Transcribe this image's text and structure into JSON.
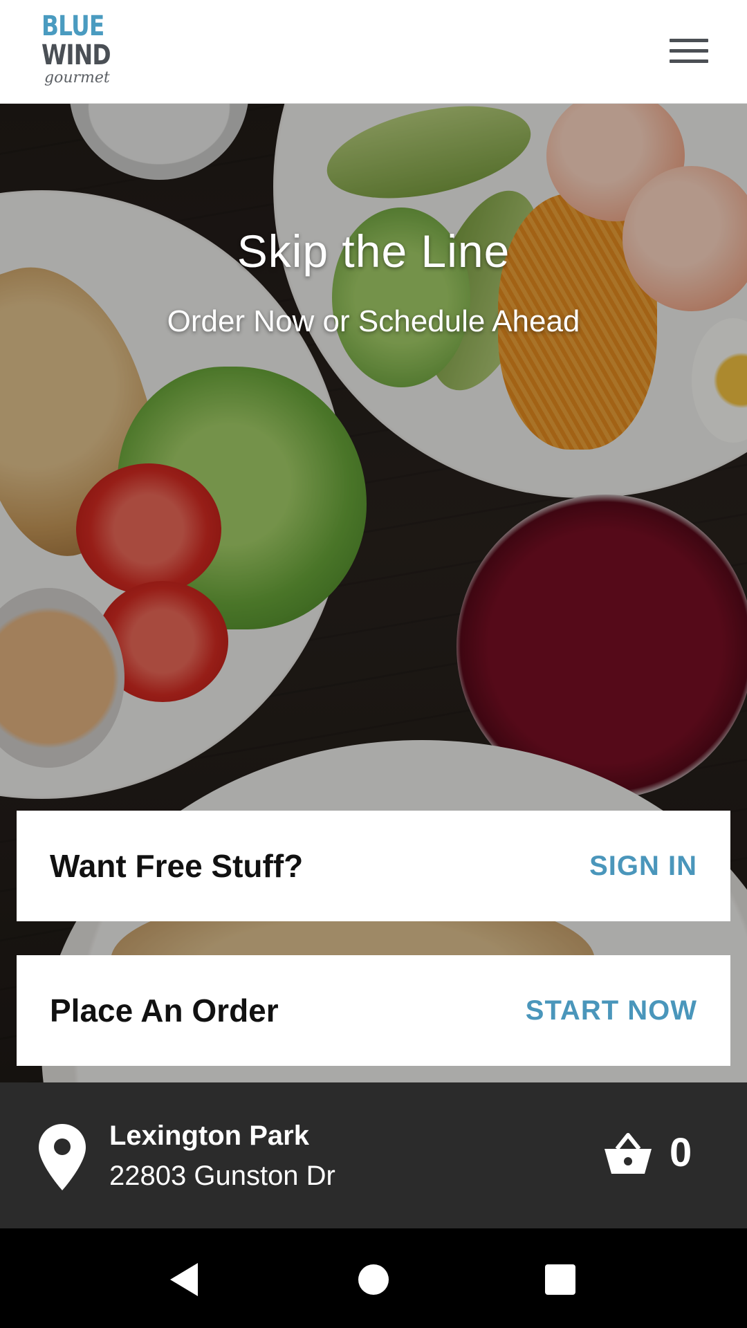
{
  "header": {
    "logo": {
      "line1": "BLUE",
      "line2": "WIND",
      "line3": "gourmet"
    },
    "menu_icon": "hamburger-menu-icon"
  },
  "hero": {
    "title": "Skip the Line",
    "subtitle": "Order Now or Schedule Ahead"
  },
  "cards": {
    "free_stuff": {
      "title": "Want Free Stuff?",
      "action": "SIGN IN"
    },
    "order": {
      "title": "Place An Order",
      "action": "START NOW"
    }
  },
  "location": {
    "name": "Lexington Park",
    "address": "22803 Gunston Dr",
    "icon": "map-pin-icon",
    "cart_icon": "basket-icon",
    "cart_count": "0"
  },
  "system_nav": {
    "back_icon": "back-triangle-icon",
    "home_icon": "home-circle-icon",
    "recent_icon": "recent-apps-square-icon"
  },
  "colors": {
    "accent": "#4a96bb",
    "logo_blue": "#4a9bc0",
    "logo_gray": "#4a4f55",
    "location_bar": "#2b2b2b",
    "nav_bar": "#000000"
  }
}
